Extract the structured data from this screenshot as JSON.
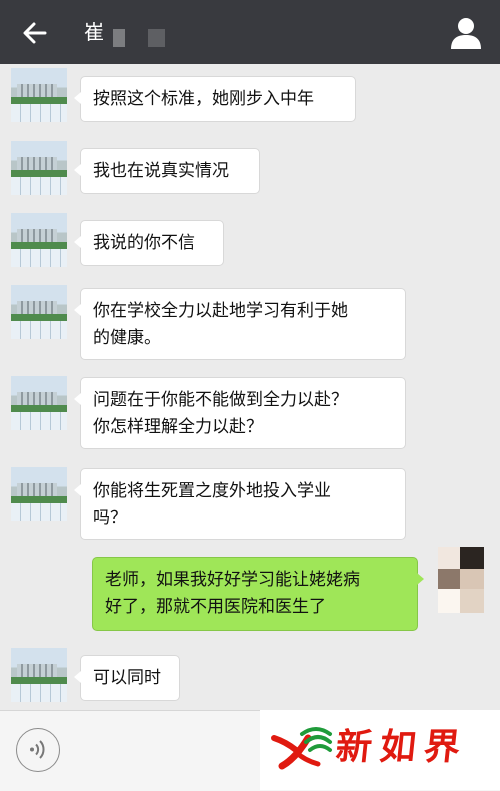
{
  "header": {
    "title": "崔",
    "back_icon": "arrow-left-icon",
    "profile_icon": "person-icon"
  },
  "messages": [
    {
      "sender": "other",
      "text": "按照这个标准，她刚步入中年"
    },
    {
      "sender": "other",
      "text": "我也在说真实情况"
    },
    {
      "sender": "other",
      "text": "我说的你不信"
    },
    {
      "sender": "other",
      "lines": [
        "你在学校全力以赴地学习有利于她",
        "的健康。"
      ]
    },
    {
      "sender": "other",
      "lines": [
        "问题在于你能不能做到全力以赴？",
        "你怎样理解全力以赴？"
      ]
    },
    {
      "sender": "other",
      "lines": [
        "你能将生死置之度外地投入学业",
        "吗？"
      ]
    },
    {
      "sender": "me",
      "lines": [
        "老师，如果我好好学习能让姥姥病",
        "好了，那就不用医院和医生了"
      ]
    },
    {
      "sender": "other",
      "text": "可以同时"
    }
  ],
  "input_bar": {
    "voice_icon": "voice-icon"
  },
  "watermark": {
    "text": "新如界"
  },
  "colors": {
    "topbar": "#393a3f",
    "background": "#ebebeb",
    "my_bubble": "#9fe658",
    "other_bubble": "#ffffff",
    "watermark_red": "#e01a10",
    "watermark_green": "#1f9b3a"
  }
}
